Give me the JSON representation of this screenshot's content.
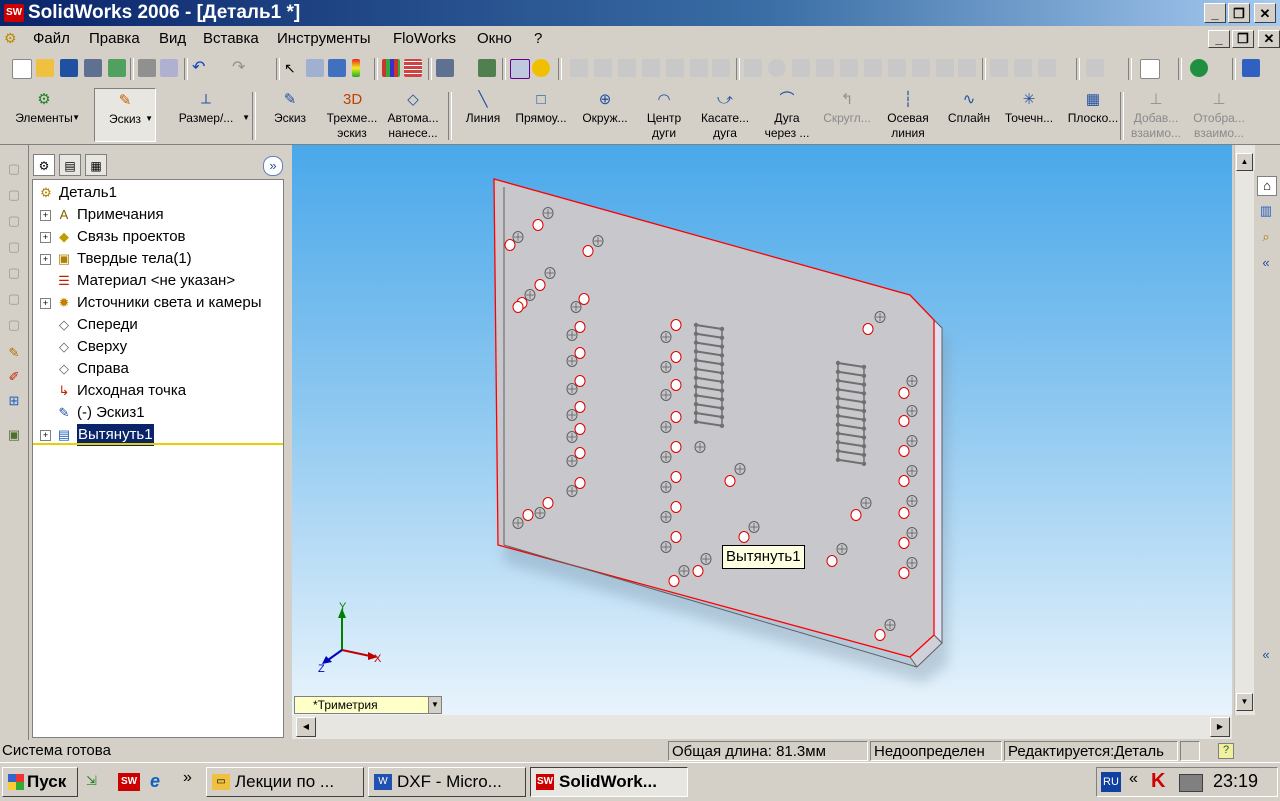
{
  "window": {
    "title": "SolidWorks 2006 - [Деталь1 *]",
    "app_icon": "SW",
    "min": "_",
    "restore": "❐",
    "close": "✕"
  },
  "menu": {
    "items": [
      "Файл",
      "Правка",
      "Вид",
      "Вставка",
      "Инструменты",
      "FloWorks",
      "Окно",
      "?"
    ]
  },
  "command_bar": {
    "items": [
      {
        "label1": "Элементы",
        "label2": "",
        "icon": "⚙"
      },
      {
        "label1": "Эскиз",
        "label2": "",
        "icon": "✎"
      },
      {
        "label1": "Размер/...",
        "label2": "",
        "icon": "⟂"
      },
      {
        "label1": "Эскиз",
        "label2": "",
        "icon": "✎"
      },
      {
        "label1": "Трехме...",
        "label2": "эскиз",
        "icon": "3D"
      },
      {
        "label1": "Автома...",
        "label2": "нанесе...",
        "icon": "◇"
      },
      {
        "label1": "Линия",
        "label2": "",
        "icon": "╲"
      },
      {
        "label1": "Прямоу...",
        "label2": "",
        "icon": "□"
      },
      {
        "label1": "Окруж...",
        "label2": "",
        "icon": "⊕"
      },
      {
        "label1": "Центр",
        "label2": "дуги",
        "icon": "◠"
      },
      {
        "label1": "Касате...",
        "label2": "дуга",
        "icon": "⤻"
      },
      {
        "label1": "Дуга",
        "label2": "через ...",
        "icon": "⌒"
      },
      {
        "label1": "Скругл...",
        "label2": "",
        "icon": "↰"
      },
      {
        "label1": "Осевая",
        "label2": "линия",
        "icon": "┆"
      },
      {
        "label1": "Сплайн",
        "label2": "",
        "icon": "∿"
      },
      {
        "label1": "Точечн...",
        "label2": "",
        "icon": "✳"
      },
      {
        "label1": "Плоско...",
        "label2": "",
        "icon": "▦"
      },
      {
        "label1": "Добав...",
        "label2": "взаимо...",
        "icon": "⊥"
      },
      {
        "label1": "Отобра...",
        "label2": "взаимо...",
        "icon": "⊥"
      }
    ]
  },
  "feature_tree": {
    "tabs": [
      "feature-manager",
      "property-manager",
      "configuration-manager"
    ],
    "collapse": "»",
    "nodes": [
      {
        "label": "Деталь1",
        "icon": "part-icon",
        "expander": "",
        "selected": false
      },
      {
        "label": "Примечания",
        "icon": "annotations-icon",
        "expander": "+",
        "selected": false
      },
      {
        "label": "Связь проектов",
        "icon": "design-binder-icon",
        "expander": "+",
        "selected": false
      },
      {
        "label": "Твердые тела(1)",
        "icon": "solid-bodies-icon",
        "expander": "+",
        "selected": false
      },
      {
        "label": "Материал <не указан>",
        "icon": "material-icon",
        "expander": "",
        "selected": false
      },
      {
        "label": "Источники света и камеры",
        "icon": "lights-icon",
        "expander": "+",
        "selected": false
      },
      {
        "label": "Спереди",
        "icon": "plane-icon",
        "expander": "",
        "selected": false
      },
      {
        "label": "Сверху",
        "icon": "plane-icon",
        "expander": "",
        "selected": false
      },
      {
        "label": "Справа",
        "icon": "plane-icon",
        "expander": "",
        "selected": false
      },
      {
        "label": "Исходная точка",
        "icon": "origin-icon",
        "expander": "",
        "selected": false
      },
      {
        "label": "(-) Эскиз1",
        "icon": "sketch-icon",
        "expander": "",
        "selected": false
      },
      {
        "label": "Вытянуть1",
        "icon": "extrude-icon",
        "expander": "+",
        "selected": true
      }
    ]
  },
  "viewport": {
    "tooltip": "Вытянуть1",
    "view_orientation": "*Триметрия",
    "triad": {
      "x": "X",
      "y": "Y",
      "z": "Z"
    }
  },
  "status": {
    "message": "Система готова",
    "length": "Общая длина: 81.3мм",
    "definition": "Недоопределен",
    "editing": "Редактируется:Деталь",
    "help": "?"
  },
  "taskbar": {
    "start": "Пуск",
    "quick_more": "»",
    "tasks": [
      {
        "label": "Лекции по ...",
        "active": false
      },
      {
        "label": "DXF - Micro...",
        "active": false
      },
      {
        "label": "SolidWork...",
        "active": true
      }
    ],
    "lang": "RU",
    "tray_more": "«",
    "clock": "23:19"
  },
  "colors": {
    "edge_highlight": "#ff0000",
    "plate": "#c8c8cc",
    "sky_top": "#4aa8ea",
    "selection": "#0a246a"
  }
}
